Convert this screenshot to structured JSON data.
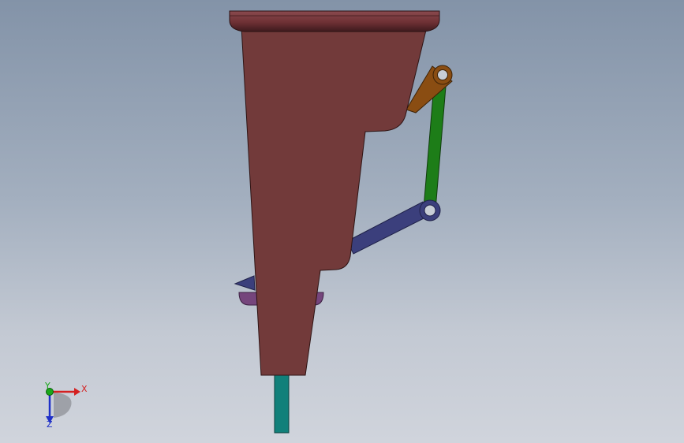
{
  "triad": {
    "x_label": "X",
    "y_label": "Y",
    "z_label": "Z"
  },
  "colors": {
    "body": "#723a3a",
    "body_cap": "#6b2f32",
    "arm_orange": "#8a4d12",
    "link_green": "#1d7d18",
    "link_navy": "#3b3f7c",
    "nozzle_teal": "#11807a",
    "tab_purple": "#75457c",
    "axis_x": "#d42020",
    "axis_y": "#1aa81a",
    "axis_z": "#1f30c8"
  }
}
